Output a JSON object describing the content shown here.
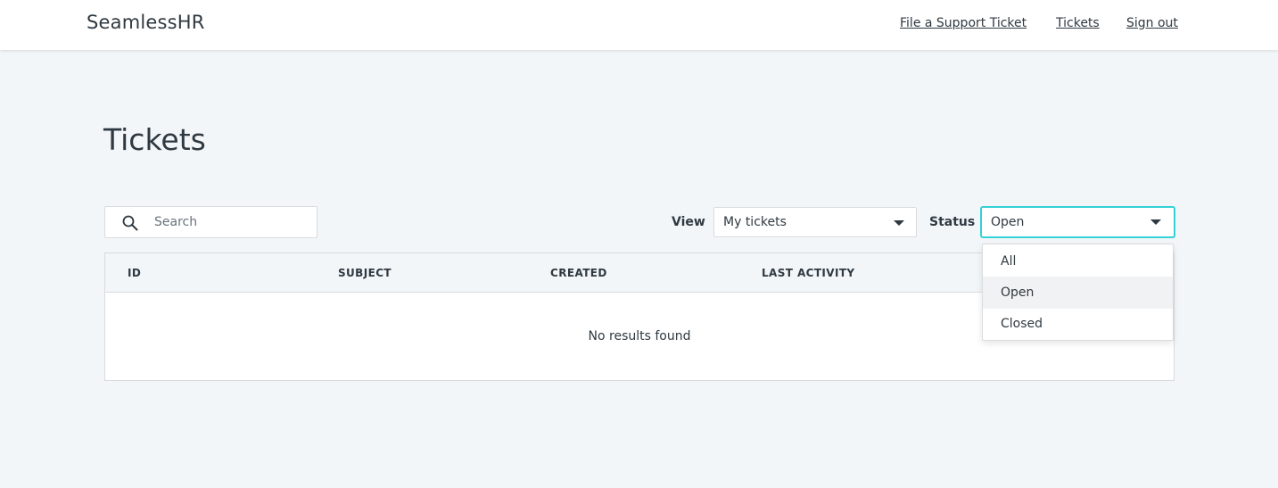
{
  "header": {
    "brand": "SeamlessHR",
    "nav": {
      "file_ticket": "File a Support Ticket",
      "tickets": "Tickets",
      "sign_out": "Sign out"
    }
  },
  "page": {
    "title": "Tickets"
  },
  "filters": {
    "search_placeholder": "Search",
    "search_icon": "search-icon",
    "view_label": "View",
    "view_value": "My tickets",
    "status_label": "Status",
    "status_value": "Open",
    "status_options": [
      "All",
      "Open",
      "Closed"
    ],
    "status_highlighted": "Open"
  },
  "table": {
    "columns": [
      "ID",
      "SUBJECT",
      "CREATED",
      "LAST ACTIVITY"
    ],
    "empty_message": "No results found"
  },
  "colors": {
    "background": "#f3f6f9",
    "focus_border": "#34d1d6",
    "text": "#2f3941"
  }
}
